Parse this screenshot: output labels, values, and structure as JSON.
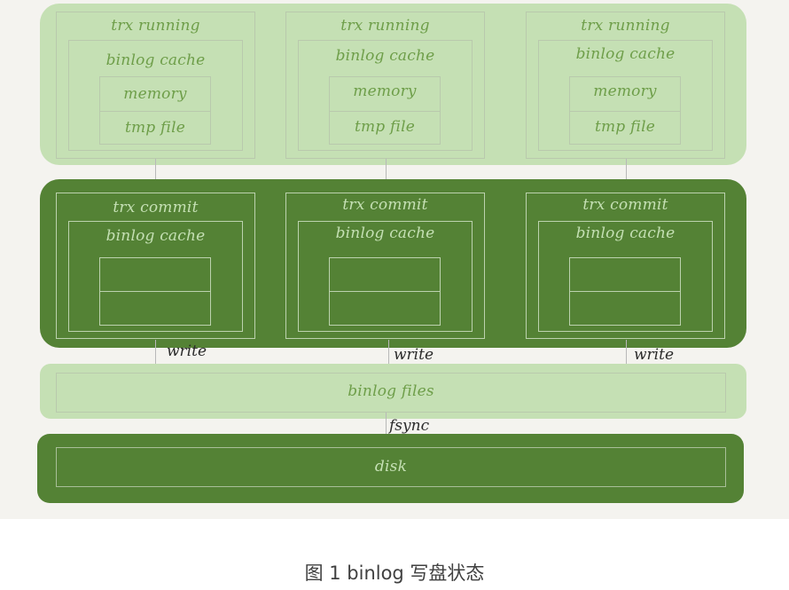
{
  "diagram": {
    "colors": {
      "light_green": "#c5e0b4",
      "dark_green": "#548235",
      "light_text": "#6e9e49",
      "background": "#f4f3ef"
    },
    "running_stage": {
      "columns": [
        {
          "title": "trx running",
          "cache_label": "binlog cache",
          "cells": [
            "memory",
            "tmp file"
          ]
        },
        {
          "title": "trx running",
          "cache_label": "binlog cache",
          "cells": [
            "memory",
            "tmp file"
          ]
        },
        {
          "title": "trx running",
          "cache_label": "binlog cache",
          "cells": [
            "memory",
            "tmp file"
          ]
        }
      ]
    },
    "commit_stage": {
      "columns": [
        {
          "title": "trx commit",
          "cache_label": "binlog cache",
          "cells": [
            "",
            ""
          ]
        },
        {
          "title": "trx commit",
          "cache_label": "binlog cache",
          "cells": [
            "",
            ""
          ]
        },
        {
          "title": "trx commit",
          "cache_label": "binlog cache",
          "cells": [
            "",
            ""
          ]
        }
      ]
    },
    "write_labels": [
      "write",
      "write",
      "write"
    ],
    "binlog_files_label": "binlog files",
    "fsync_label": "fsync",
    "disk_label": "disk"
  },
  "caption": "图 1 binlog 写盘状态"
}
